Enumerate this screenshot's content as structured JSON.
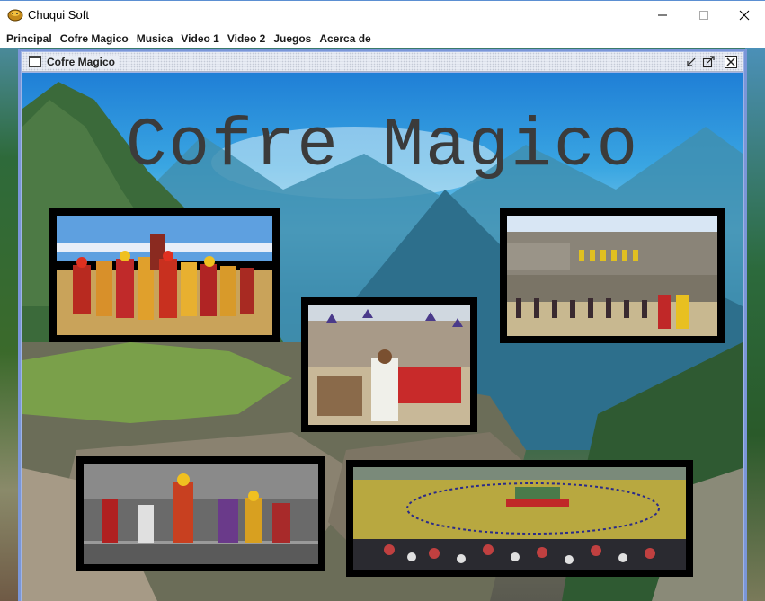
{
  "window": {
    "title": "Chuqui Soft",
    "icon": "app-logo-icon",
    "controls": [
      "minimize-icon",
      "maximize-icon",
      "close-icon"
    ]
  },
  "menubar": {
    "items": [
      "Principal",
      "Cofre Magico",
      "Musica",
      "Video 1",
      "Video 2",
      "Juegos",
      "Acerca de"
    ]
  },
  "internal_frame": {
    "title": "Cofre Magico",
    "controls": [
      "iconify-icon",
      "maximize-icon",
      "close-icon"
    ]
  },
  "content": {
    "heading": "Cofre Magico",
    "background": "mountain-ruins-landscape",
    "photos": [
      {
        "name": "photo-inca-procession"
      },
      {
        "name": "photo-ruins-ceremony"
      },
      {
        "name": "photo-ritual-priest"
      },
      {
        "name": "photo-inca-dancers"
      },
      {
        "name": "photo-festival-field"
      }
    ]
  },
  "colors": {
    "frame_border": "#7a96d8",
    "heading": "#3b3b3b",
    "photo_border": "#000000"
  }
}
